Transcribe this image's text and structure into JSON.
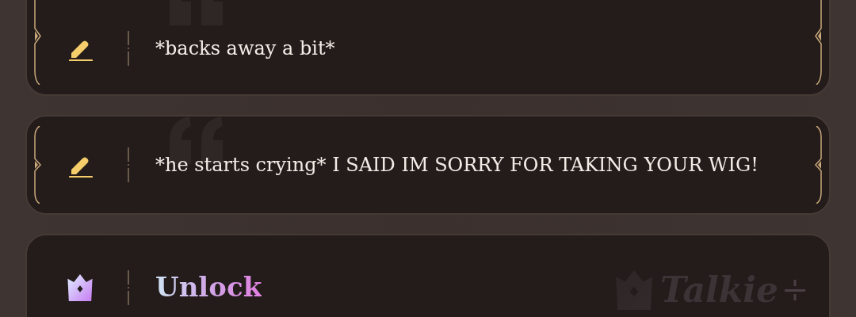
{
  "messages": [
    {
      "text": "*backs away a bit*"
    },
    {
      "text": "*he starts crying* I SAID IM SORRY FOR TAKING YOUR WIG!"
    }
  ],
  "unlock": {
    "label": "Unlock",
    "brand": "Talkie"
  }
}
